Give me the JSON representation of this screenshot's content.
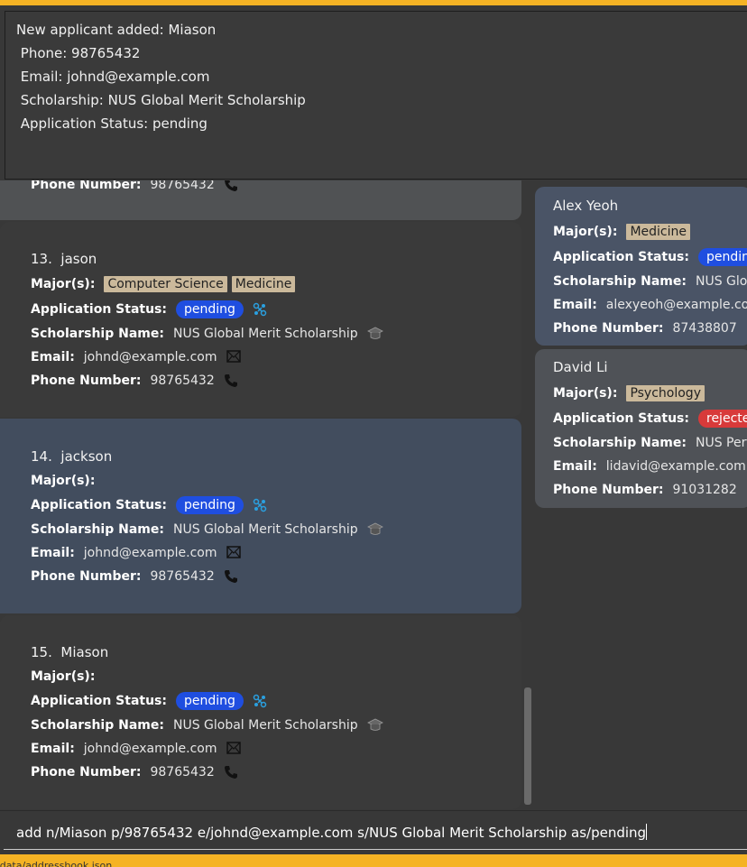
{
  "result": {
    "lines": [
      "New applicant added: Miason",
      " Phone: 98765432",
      " Email: johnd@example.com",
      " Scholarship: NUS Global Merit Scholarship",
      " Application Status: pending"
    ]
  },
  "labels": {
    "major": "Major(s):",
    "status": "Application Status:",
    "scholarship": "Scholarship Name:",
    "email": "Email:",
    "phone": "Phone Number:"
  },
  "partial_card": {
    "phone_label": "Phone Number:",
    "phone": "98765432"
  },
  "applicants": [
    {
      "index": "13.",
      "name": "jason",
      "majors": [
        "Computer Science",
        "Medicine"
      ],
      "status": "pending",
      "scholarship": "NUS Global Merit Scholarship",
      "email": "johnd@example.com",
      "phone": "98765432"
    },
    {
      "index": "14.",
      "name": "jackson",
      "majors": [],
      "status": "pending",
      "scholarship": "NUS Global Merit Scholarship",
      "email": "johnd@example.com",
      "phone": "98765432"
    },
    {
      "index": "15.",
      "name": "Miason",
      "majors": [],
      "status": "pending",
      "scholarship": "NUS Global Merit Scholarship",
      "email": "johnd@example.com",
      "phone": "98765432"
    }
  ],
  "side_panel": [
    {
      "name": "Alex Yeoh",
      "majors": [
        "Medicine"
      ],
      "status": "pending",
      "scholarship": "NUS Global",
      "email": "alexyeoh@example.com",
      "phone": "87438807"
    },
    {
      "name": "David Li",
      "majors": [
        "Psychology"
      ],
      "status": "rejected",
      "scholarship": "NUS Perfor",
      "email": "lidavid@example.com",
      "phone": "91031282"
    }
  ],
  "command": {
    "value": "add n/Miason p/98765432 e/johnd@example.com s/NUS Global Merit Scholarship as/pending"
  },
  "status_bar": {
    "text": "/data/addressbook.json"
  },
  "colors": {
    "accent": "#f5b324",
    "pending": "#1f4ee0",
    "rejected": "#d83a3a",
    "major_tag": "#cbb99b",
    "selected_card": "#424d5e"
  }
}
